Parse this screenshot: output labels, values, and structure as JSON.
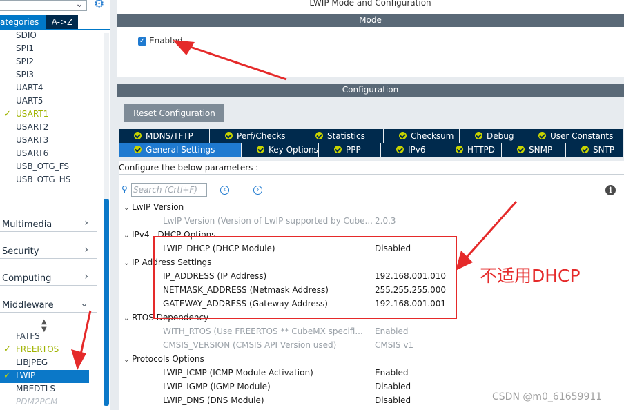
{
  "left": {
    "search_value": "",
    "tabs": {
      "categories": "ategories",
      "az": "A->Z"
    },
    "peripherals": [
      "SDIO",
      "SPI1",
      "SPI2",
      "SPI3",
      "UART4",
      "UART5",
      "USART1",
      "USART2",
      "USART3",
      "USART6",
      "USB_OTG_FS",
      "USB_OTG_HS"
    ],
    "categories": [
      "Multimedia",
      "Security",
      "Computing",
      "Middleware"
    ],
    "middleware": [
      "FATFS",
      "FREERTOS",
      "LIBJPEG",
      "LWIP",
      "MBEDTLS",
      "PDM2PCM"
    ],
    "selected": "LWIP"
  },
  "mode": {
    "window_title": "LWIP Mode and Configuration",
    "section_title": "Mode",
    "enabled_label": "Enabled",
    "enabled": true
  },
  "configuration": {
    "section_title": "Configuration",
    "reset_button": "Reset Configuration",
    "tabs_row1": [
      "MDNS/TFTP",
      "Perf/Checks",
      "Statistics",
      "Checksum",
      "Debug",
      "User Constants"
    ],
    "tabs_row2": [
      "General Settings",
      "Key Options",
      "PPP",
      "IPv6",
      "HTTPD",
      "SNMP",
      "SNTP"
    ],
    "active_tab": "General Settings",
    "params_header": "Configure the below parameters :",
    "search_placeholder": "Search (Crtl+F)",
    "groups": [
      {
        "name": "LwIP Version",
        "params": [
          {
            "name": "LwIP Version (Version of LwIP supported by Cube...",
            "value": "2.0.3",
            "dim": true
          }
        ]
      },
      {
        "name": "IPv4 - DHCP Options",
        "params": [
          {
            "name": "LWIP_DHCP (DHCP Module)",
            "value": "Disabled",
            "dim": false
          }
        ]
      },
      {
        "name": "IP Address Settings",
        "params": [
          {
            "name": "IP_ADDRESS (IP Address)",
            "value": "192.168.001.010",
            "dim": false
          },
          {
            "name": "NETMASK_ADDRESS (Netmask Address)",
            "value": "255.255.255.000",
            "dim": false
          },
          {
            "name": "GATEWAY_ADDRESS (Gateway Address)",
            "value": "192.168.001.001",
            "dim": false
          }
        ]
      },
      {
        "name": "RTOS Dependency",
        "params": [
          {
            "name": "WITH_RTOS (Use FREERTOS ** CubeMX specifi...",
            "value": "Enabled",
            "dim": true
          },
          {
            "name": "CMSIS_VERSION (CMSIS API Version used)",
            "value": "CMSIS v1",
            "dim": true
          }
        ]
      },
      {
        "name": "Protocols Options",
        "params": [
          {
            "name": "LWIP_ICMP (ICMP Module Activation)",
            "value": "Enabled",
            "dim": false
          },
          {
            "name": "LWIP_IGMP (IGMP Module)",
            "value": "Disabled",
            "dim": false
          },
          {
            "name": "LWIP_DNS (DNS Module)",
            "value": "Disabled",
            "dim": false
          }
        ]
      }
    ]
  },
  "annotation": {
    "text": "不适用DHCP",
    "color": "#e52a2a"
  },
  "watermark": "CSDN @m0_61659911",
  "colors": {
    "accent": "#1f7ad0",
    "tab_dark": "#002a4d",
    "header_bar": "#5a6977",
    "green_ok": "#9fb300"
  }
}
